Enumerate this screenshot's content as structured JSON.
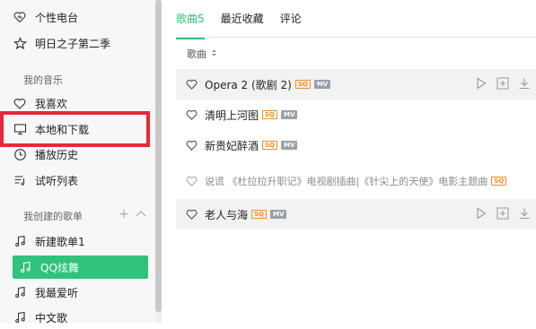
{
  "sidebar": {
    "top_items": [
      {
        "label": "个性电台",
        "icon": "radio-icon"
      },
      {
        "label": "明日之子第二季",
        "icon": "star-icon"
      }
    ],
    "my_music_heading": "我的音乐",
    "my_music_items": [
      {
        "label": "我喜欢",
        "icon": "heart-icon"
      },
      {
        "label": "本地和下载",
        "icon": "monitor-icon"
      },
      {
        "label": "播放历史",
        "icon": "clock-icon"
      },
      {
        "label": "试听列表",
        "icon": "playlist-icon"
      }
    ],
    "created_heading": "我创建的歌单",
    "playlists": [
      {
        "label": "新建歌单1",
        "icon": "music-note-icon",
        "active": false
      },
      {
        "label": "QQ炫舞",
        "icon": "music-note-icon",
        "active": true
      },
      {
        "label": "我最爱听",
        "icon": "music-note-icon",
        "active": false
      },
      {
        "label": "中文歌",
        "icon": "music-note-icon",
        "active": false
      }
    ]
  },
  "tabs": [
    {
      "label": "歌曲5",
      "active": true
    },
    {
      "label": "最近收藏",
      "active": false
    },
    {
      "label": "评论",
      "active": false
    }
  ],
  "column_header": "歌曲",
  "songs": [
    {
      "title": "Opera 2 (歌剧 2)",
      "sq": "SQ",
      "mv": "MV",
      "dim": false
    },
    {
      "title": "清明上河图",
      "sq": "SQ",
      "mv": "MV",
      "dim": false
    },
    {
      "title": "新贵妃醉酒",
      "sq": "SQ",
      "mv": "MV",
      "dim": false
    },
    {
      "title": "说谎 《杜拉拉升职记》电视剧插曲|《针尖上的天使》电影主题曲",
      "sq": "SQ",
      "mv": "",
      "dim": true
    },
    {
      "title": "老人与海",
      "sq": "SQ",
      "mv": "MV",
      "dim": false
    }
  ],
  "colors": {
    "accent": "#31c27c",
    "highlight": "#e8283b",
    "sq_badge": "#f08c28"
  }
}
